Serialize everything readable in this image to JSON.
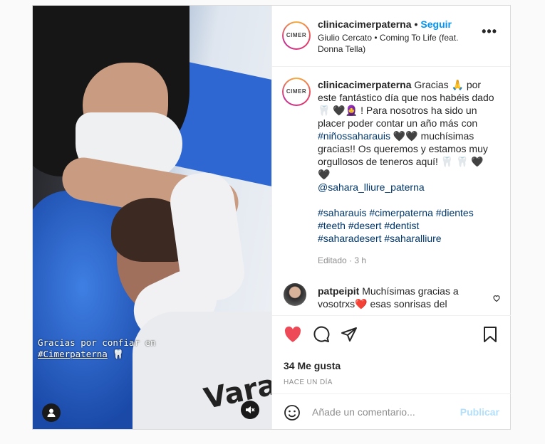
{
  "post": {
    "username": "clinicacimerpaterna",
    "follow_label": "Seguir",
    "song": "Giulio Cercato • Coming To Life (feat. Donna Tella)",
    "more_icon": "•••",
    "avatar_text": "CIMER",
    "media": {
      "caption_line1": "Gracias por confiar en",
      "caption_tag": "#Cimerpaterna",
      "caption_emoji": "🦷",
      "shirt_text": "Vara"
    },
    "caption": {
      "username": "clinicacimerpaterna",
      "text_part1": "Gracias 🙏  por este fantástico día que nos habéis dado 🦷 🖤🧕 ! Para nosotros ha sido un placer poder contar un año más con",
      "hashtag1": "#niñossaharauis",
      "text_part2": "🖤🖤 muchísimas gracias!! Os queremos y estamos muy orgullosos de teneros aquí! 🦷 🦷 🖤🖤",
      "mention": "@sahara_lliure_paterna",
      "hashtags_line1": "#saharauis #cimerpaterna #dientes",
      "hashtags_line2": "#teeth #desert #dentist",
      "hashtags_line3": "#saharadesert #saharalliure",
      "edited": "Editado · 3 h"
    },
    "comment": {
      "username": "patpeipit",
      "text": "Muchísimas gracias a vosotrxs❤️  esas sonrisas del"
    },
    "likes": "34 Me gusta",
    "date": "HACE UN DÍA",
    "add_comment_placeholder": "Añade un comentario...",
    "publish_label": "Publicar"
  }
}
